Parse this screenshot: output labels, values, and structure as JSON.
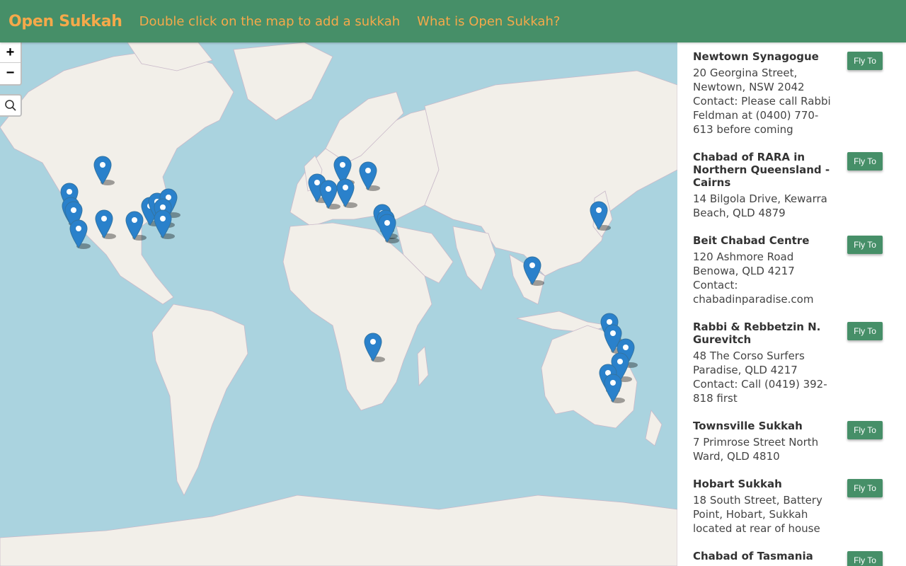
{
  "header": {
    "brand": "Open Sukkah",
    "links": [
      "Double click on the map to add a sukkah",
      "What is Open Sukkah?"
    ]
  },
  "map": {
    "zoom_in": "+",
    "zoom_out": "−",
    "water_color": "#aad3df",
    "land_color": "#f2efe9",
    "marker_color": "#2a81cb"
  },
  "sidebar": {
    "fly_label": "Fly To",
    "entries": [
      {
        "title": "Newtown Synagogue",
        "address": "20 Georgina Street, Newtown, NSW 2042 Contact: Please call Rabbi Feldman at (0400) 770-613 before coming"
      },
      {
        "title": "Chabad of RARA in Northern Queensland - Cairns",
        "address": "14 Bilgola Drive, Kewarra Beach, QLD 4879"
      },
      {
        "title": "Beit Chabad Centre",
        "address": "120 Ashmore Road Benowa, QLD 4217 Contact: chabadinparadise.com"
      },
      {
        "title": "Rabbi & Rebbetzin N. Gurevitch",
        "address": "48 The Corso Surfers Paradise, QLD 4217 Contact: Call (0419) 392-818 first"
      },
      {
        "title": "Townsville Sukkah",
        "address": "7 Primrose Street North Ward, QLD 4810"
      },
      {
        "title": "Hobart Sukkah",
        "address": "18 South Street, Battery Point, Hobart, Sukkah located at rear of house"
      },
      {
        "title": "Chabad of Tasmania",
        "address": ""
      }
    ]
  }
}
